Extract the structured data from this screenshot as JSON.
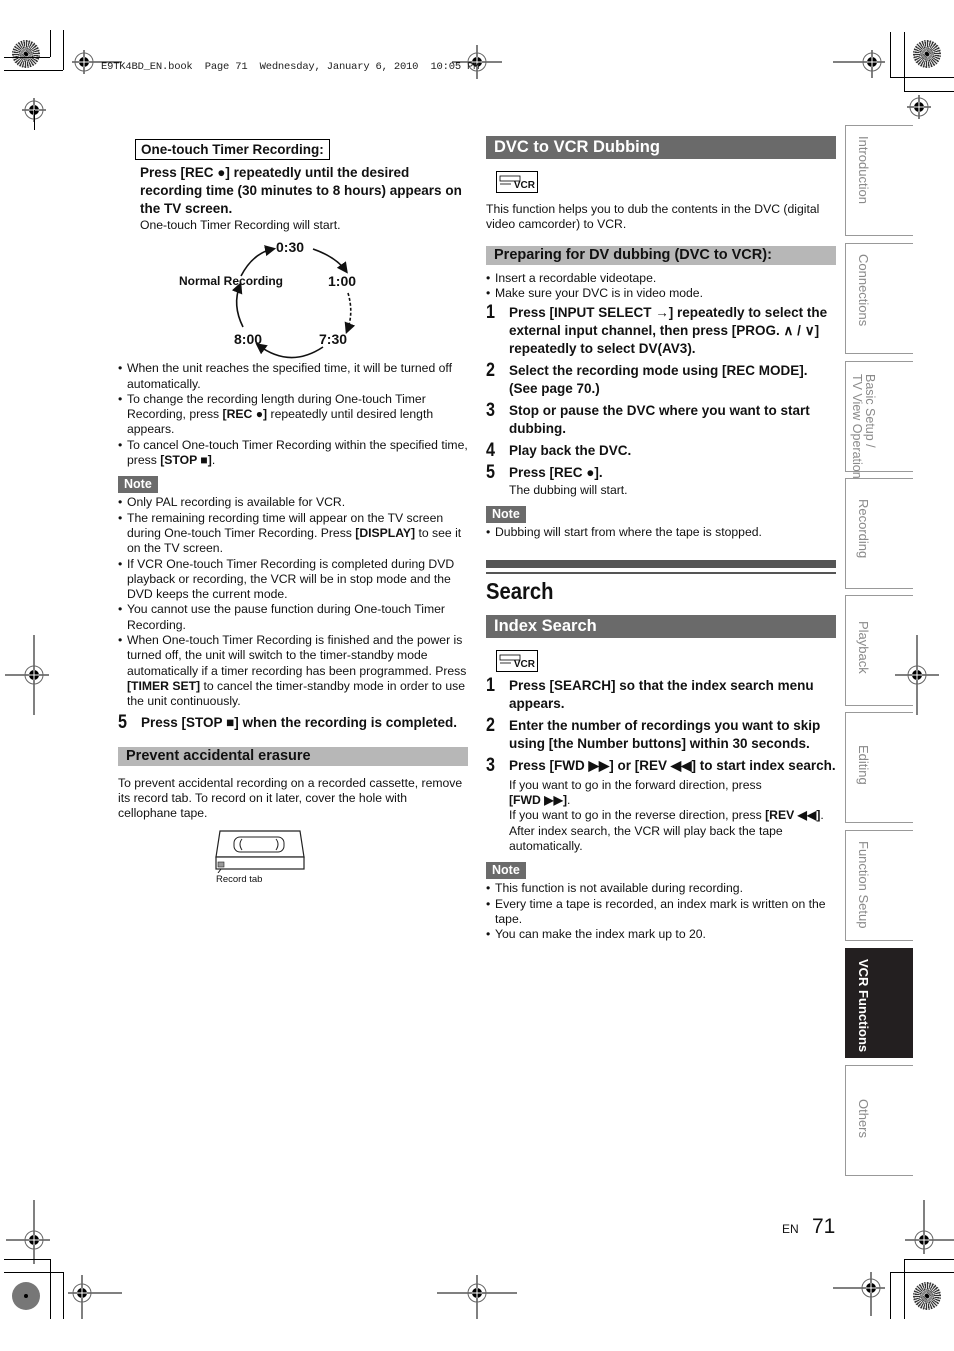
{
  "header": {
    "slug": "E9TK4BD_EN.book  Page 71  Wednesday, January 6, 2010  10:05 PM"
  },
  "left": {
    "otr_title": "One-touch Timer Recording:",
    "otr_step": "Press [REC ●] repeatedly until the desired recording time (30 minutes to 8 hours) appears on the TV screen.",
    "otr_result": "One-touch Timer Recording will start.",
    "cycle": {
      "normal": "Normal Recording",
      "t030": "0:30",
      "t100": "1:00",
      "t730": "7:30",
      "t800": "8:00"
    },
    "bullets": [
      {
        "pre": "When the unit reaches the specified time, it will be turned off automatically.",
        "bold": "",
        "post": ""
      },
      {
        "pre": "To change the recording length during One-touch Timer Recording, press ",
        "bold": "[REC ●]",
        "post": " repeatedly until desired length appears."
      },
      {
        "pre": "To cancel One-touch Timer Recording within the specified time, press ",
        "bold": "[STOP ■]",
        "post": "."
      }
    ],
    "note_label": "Note",
    "notes": [
      {
        "pre": "Only PAL recording is available for VCR.",
        "bold": "",
        "post": ""
      },
      {
        "pre": "The remaining recording time will appear on the TV screen during One-touch Timer Recording. Press ",
        "bold": "[DISPLAY]",
        "post": " to see it on the TV screen."
      },
      {
        "pre": "If VCR One-touch Timer Recording is completed during DVD playback or recording, the VCR will be in stop mode and the DVD keeps the current mode.",
        "bold": "",
        "post": ""
      },
      {
        "pre": "You cannot use the pause function during One-touch Timer Recording.",
        "bold": "",
        "post": ""
      },
      {
        "pre": "When One-touch Timer Recording is finished and the power is turned off, the unit will switch to the timer-standby mode automatically if a timer recording has been programmed. Press ",
        "bold": "[TIMER SET]",
        "post": " to cancel the timer-standby mode in order to use the unit continuously."
      }
    ],
    "step5_num": "5",
    "step5_text": "Press [STOP ■] when the recording is completed.",
    "prevent_title": "Prevent accidental erasure",
    "prevent_text": "To prevent accidental recording on a recorded cassette, remove its record tab. To record on it later, cover the hole with cellophane tape.",
    "record_tab_label": "Record tab"
  },
  "right": {
    "dvc_title": "DVC to VCR Dubbing",
    "vcr_icon_label": "VCR",
    "dvc_intro": "This function helps you to dub the contents in the DVC (digital video camcorder) to VCR.",
    "prep_title": "Preparing for DV dubbing (DVC to VCR):",
    "prep_bullets": [
      "Insert a recordable videotape.",
      "Make sure your DVC is in video mode."
    ],
    "dvc_steps": [
      {
        "num": "1",
        "text": "Press [INPUT SELECT →] repeatedly to select the external input channel, then press [PROG. ∧ / ∨] repeatedly to select DV(AV3)."
      },
      {
        "num": "2",
        "text": "Select the recording mode using [REC MODE]. (See page 70.)"
      },
      {
        "num": "3",
        "text": "Stop or pause the DVC where you want to start dubbing."
      },
      {
        "num": "4",
        "text": "Play back the DVC."
      },
      {
        "num": "5",
        "text": "Press [REC ●]."
      }
    ],
    "dvc_step5_result": "The dubbing will start.",
    "note_label": "Note",
    "dvc_notes": [
      "Dubbing will start from where the tape is stopped."
    ],
    "search_title": "Search",
    "index_title": "Index Search",
    "index_steps": [
      {
        "num": "1",
        "text": "Press [SEARCH] so that the index search menu appears."
      },
      {
        "num": "2",
        "text": "Enter the number of recordings you want to skip using [the Number buttons] within 30 seconds."
      },
      {
        "num": "3",
        "text": "Press [FWD ▶▶] or [REV ◀◀] to start index search."
      }
    ],
    "index_step3_detail": {
      "fwd_pre": "If you want to go in the forward direction, press ",
      "fwd_bold": "[FWD ▶▶]",
      "fwd_post": ".",
      "rev_pre": "If you want to go in the reverse direction, press ",
      "rev_bold": "[REV ◀◀]",
      "rev_post": ".",
      "after": "After index search, the VCR will play back the tape automatically."
    },
    "index_notes": [
      "This function is not available during recording.",
      "Every time a tape is recorded, an index mark is written on the tape.",
      "You can make the index mark up to 20."
    ]
  },
  "side_tabs": [
    {
      "label": "Introduction",
      "active": false
    },
    {
      "label": "Connections",
      "active": false
    },
    {
      "label": "Basic Setup /\nTV View Operation",
      "active": false
    },
    {
      "label": "Recording",
      "active": false
    },
    {
      "label": "Playback",
      "active": false
    },
    {
      "label": "Editing",
      "active": false
    },
    {
      "label": "Function Setup",
      "active": false
    },
    {
      "label": "VCR Functions",
      "active": true
    },
    {
      "label": "Others",
      "active": false
    }
  ],
  "footer": {
    "lang": "EN",
    "page_number": "71"
  }
}
